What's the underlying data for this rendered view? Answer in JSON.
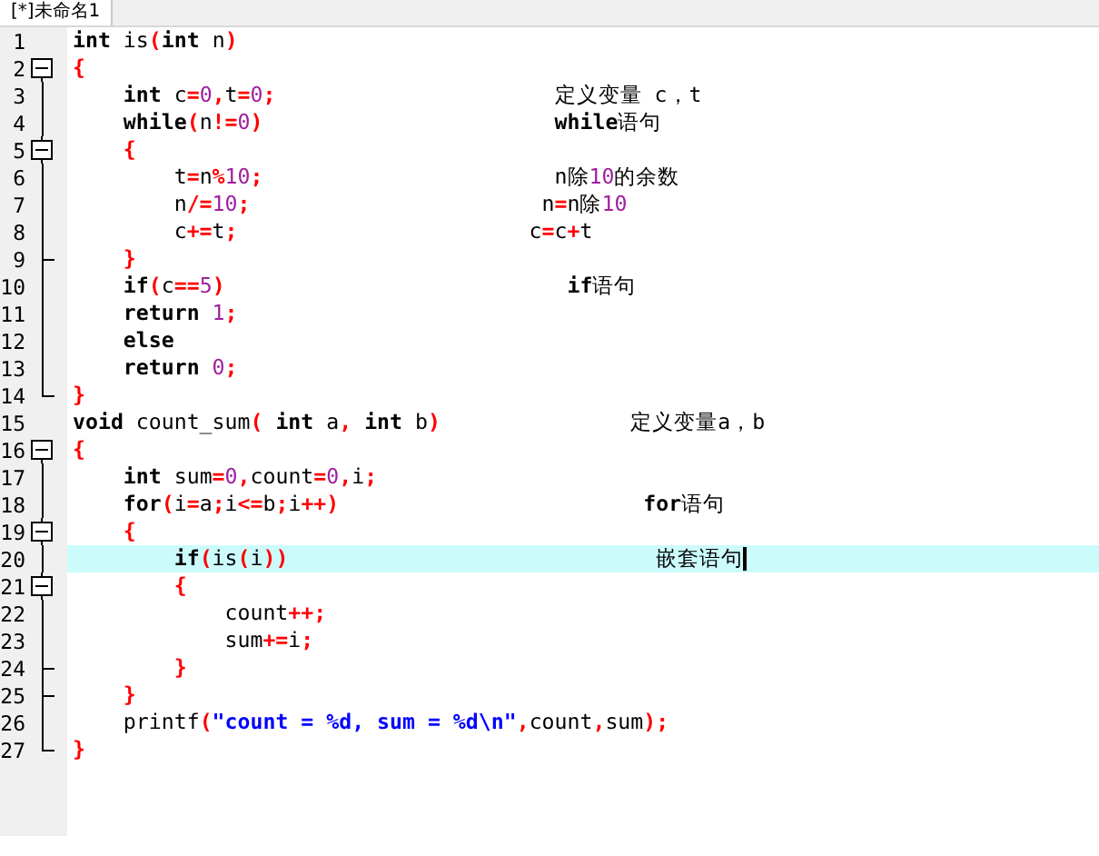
{
  "tab": {
    "label": "[*]未命名1",
    "selected": true
  },
  "lines": [
    {
      "number": "1",
      "tokens": [
        {
          "kind": "keyword",
          "text": "int"
        },
        {
          "kind": "ident",
          "text": " is"
        },
        {
          "kind": "op",
          "text": "("
        },
        {
          "kind": "keyword",
          "text": "int"
        },
        {
          "kind": "ident",
          "text": " n"
        },
        {
          "kind": "op",
          "text": ")"
        }
      ]
    },
    {
      "number": "2",
      "kind": "open",
      "expanded": true,
      "tokens": [
        {
          "kind": "op",
          "text": "{"
        }
      ]
    },
    {
      "number": "3",
      "tokens": [
        {
          "kind": "keyword",
          "text": "    int"
        },
        {
          "kind": "ident",
          "text": " c"
        },
        {
          "kind": "op",
          "text": "="
        },
        {
          "kind": "number",
          "text": "0"
        },
        {
          "kind": "op",
          "text": ","
        },
        {
          "kind": "ident",
          "text": "t"
        },
        {
          "kind": "op",
          "text": "="
        },
        {
          "kind": "number",
          "text": "0"
        },
        {
          "kind": "op",
          "text": ";"
        },
        {
          "kind": "note",
          "text": "                      定义变量 c，t"
        }
      ]
    },
    {
      "number": "4",
      "tokens": [
        {
          "kind": "keyword",
          "text": "    while"
        },
        {
          "kind": "op",
          "text": "("
        },
        {
          "kind": "ident",
          "text": "n"
        },
        {
          "kind": "op",
          "text": "!="
        },
        {
          "kind": "number",
          "text": "0"
        },
        {
          "kind": "op",
          "text": ")"
        },
        {
          "kind": "keyword",
          "text": "                       while"
        },
        {
          "kind": "note",
          "text": "语句"
        }
      ]
    },
    {
      "number": "5",
      "kind": "open",
      "expanded": true,
      "tokens": [
        {
          "kind": "op",
          "text": "    {"
        }
      ]
    },
    {
      "number": "6",
      "tokens": [
        {
          "kind": "ident",
          "text": "        t"
        },
        {
          "kind": "op",
          "text": "="
        },
        {
          "kind": "ident",
          "text": "n"
        },
        {
          "kind": "op",
          "text": "%"
        },
        {
          "kind": "number",
          "text": "10"
        },
        {
          "kind": "op",
          "text": ";"
        },
        {
          "kind": "note",
          "text": "                       n除"
        },
        {
          "kind": "number",
          "text": "10"
        },
        {
          "kind": "note",
          "text": "的余数"
        }
      ]
    },
    {
      "number": "7",
      "tokens": [
        {
          "kind": "ident",
          "text": "        n"
        },
        {
          "kind": "op",
          "text": "/="
        },
        {
          "kind": "number",
          "text": "10"
        },
        {
          "kind": "op",
          "text": ";"
        },
        {
          "kind": "ident",
          "text": "                       n"
        },
        {
          "kind": "op",
          "text": "="
        },
        {
          "kind": "note",
          "text": "n除"
        },
        {
          "kind": "number",
          "text": "10"
        }
      ]
    },
    {
      "number": "8",
      "tokens": [
        {
          "kind": "ident",
          "text": "        c"
        },
        {
          "kind": "op",
          "text": "+="
        },
        {
          "kind": "ident",
          "text": "t"
        },
        {
          "kind": "op",
          "text": ";"
        },
        {
          "kind": "ident",
          "text": "                       c"
        },
        {
          "kind": "op",
          "text": "="
        },
        {
          "kind": "ident",
          "text": "c"
        },
        {
          "kind": "op",
          "text": "+"
        },
        {
          "kind": "ident",
          "text": "t"
        }
      ]
    },
    {
      "number": "9",
      "kind": "close",
      "tokens": [
        {
          "kind": "op",
          "text": "    }"
        }
      ]
    },
    {
      "number": "10",
      "tokens": [
        {
          "kind": "keyword",
          "text": "    if"
        },
        {
          "kind": "op",
          "text": "("
        },
        {
          "kind": "ident",
          "text": "c"
        },
        {
          "kind": "op",
          "text": "=="
        },
        {
          "kind": "number",
          "text": "5"
        },
        {
          "kind": "op",
          "text": ")"
        },
        {
          "kind": "keyword",
          "text": "                           if"
        },
        {
          "kind": "note",
          "text": "语句"
        }
      ]
    },
    {
      "number": "11",
      "tokens": [
        {
          "kind": "keyword",
          "text": "    return"
        },
        {
          "kind": "number",
          "text": " 1"
        },
        {
          "kind": "op",
          "text": ";"
        }
      ]
    },
    {
      "number": "12",
      "tokens": [
        {
          "kind": "keyword",
          "text": "    else"
        }
      ]
    },
    {
      "number": "13",
      "tokens": [
        {
          "kind": "keyword",
          "text": "    return"
        },
        {
          "kind": "number",
          "text": " 0"
        },
        {
          "kind": "op",
          "text": ";"
        }
      ]
    },
    {
      "number": "14",
      "kind": "close",
      "tokens": [
        {
          "kind": "op",
          "text": "}"
        }
      ]
    },
    {
      "number": "15",
      "tokens": [
        {
          "kind": "keyword",
          "text": "void"
        },
        {
          "kind": "ident",
          "text": " count_sum"
        },
        {
          "kind": "op",
          "text": "("
        },
        {
          "kind": "keyword",
          "text": " int"
        },
        {
          "kind": "ident",
          "text": " a"
        },
        {
          "kind": "op",
          "text": ","
        },
        {
          "kind": "keyword",
          "text": " int"
        },
        {
          "kind": "ident",
          "text": " b"
        },
        {
          "kind": "op",
          "text": ")"
        },
        {
          "kind": "note",
          "text": "               定义变量a，b"
        }
      ]
    },
    {
      "number": "16",
      "kind": "open",
      "expanded": true,
      "tokens": [
        {
          "kind": "op",
          "text": "{"
        }
      ]
    },
    {
      "number": "17",
      "tokens": [
        {
          "kind": "keyword",
          "text": "    int"
        },
        {
          "kind": "ident",
          "text": " sum"
        },
        {
          "kind": "op",
          "text": "="
        },
        {
          "kind": "number",
          "text": "0"
        },
        {
          "kind": "op",
          "text": ","
        },
        {
          "kind": "ident",
          "text": "count"
        },
        {
          "kind": "op",
          "text": "="
        },
        {
          "kind": "number",
          "text": "0"
        },
        {
          "kind": "op",
          "text": ","
        },
        {
          "kind": "ident",
          "text": "i"
        },
        {
          "kind": "op",
          "text": ";"
        }
      ]
    },
    {
      "number": "18",
      "tokens": [
        {
          "kind": "keyword",
          "text": "    for"
        },
        {
          "kind": "op",
          "text": "("
        },
        {
          "kind": "ident",
          "text": "i"
        },
        {
          "kind": "op",
          "text": "="
        },
        {
          "kind": "ident",
          "text": "a"
        },
        {
          "kind": "op",
          "text": ";"
        },
        {
          "kind": "ident",
          "text": "i"
        },
        {
          "kind": "op",
          "text": "<="
        },
        {
          "kind": "ident",
          "text": "b"
        },
        {
          "kind": "op",
          "text": ";"
        },
        {
          "kind": "ident",
          "text": "i"
        },
        {
          "kind": "op",
          "text": "++)"
        },
        {
          "kind": "keyword",
          "text": "                        for"
        },
        {
          "kind": "note",
          "text": "语句"
        }
      ]
    },
    {
      "number": "19",
      "kind": "open",
      "expanded": true,
      "tokens": [
        {
          "kind": "op",
          "text": "    {"
        }
      ]
    },
    {
      "number": "20",
      "current": true,
      "cursor": true,
      "tokens": [
        {
          "kind": "keyword",
          "text": "        if"
        },
        {
          "kind": "op",
          "text": "("
        },
        {
          "kind": "ident",
          "text": "is"
        },
        {
          "kind": "op",
          "text": "("
        },
        {
          "kind": "ident",
          "text": "i"
        },
        {
          "kind": "op",
          "text": "))"
        },
        {
          "kind": "note",
          "text": "                             嵌套语句"
        }
      ]
    },
    {
      "number": "21",
      "kind": "open",
      "expanded": true,
      "tokens": [
        {
          "kind": "op",
          "text": "        {"
        }
      ]
    },
    {
      "number": "22",
      "tokens": [
        {
          "kind": "ident",
          "text": "            count"
        },
        {
          "kind": "op",
          "text": "++;"
        }
      ]
    },
    {
      "number": "23",
      "tokens": [
        {
          "kind": "ident",
          "text": "            sum"
        },
        {
          "kind": "op",
          "text": "+="
        },
        {
          "kind": "ident",
          "text": "i"
        },
        {
          "kind": "op",
          "text": ";"
        }
      ]
    },
    {
      "number": "24",
      "kind": "close",
      "tokens": [
        {
          "kind": "op",
          "text": "        }"
        }
      ]
    },
    {
      "number": "25",
      "kind": "close",
      "tokens": [
        {
          "kind": "op",
          "text": "    }"
        }
      ]
    },
    {
      "number": "26",
      "tokens": [
        {
          "kind": "ident",
          "text": "    printf"
        },
        {
          "kind": "op",
          "text": "("
        },
        {
          "kind": "string",
          "text": "\"count = %d, sum = %d\\n\""
        },
        {
          "kind": "op",
          "text": ","
        },
        {
          "kind": "ident",
          "text": "count"
        },
        {
          "kind": "op",
          "text": ","
        },
        {
          "kind": "ident",
          "text": "sum"
        },
        {
          "kind": "op",
          "text": ");"
        }
      ]
    },
    {
      "number": "27",
      "kind": "close",
      "tokens": [
        {
          "kind": "op",
          "text": "}"
        }
      ]
    }
  ]
}
